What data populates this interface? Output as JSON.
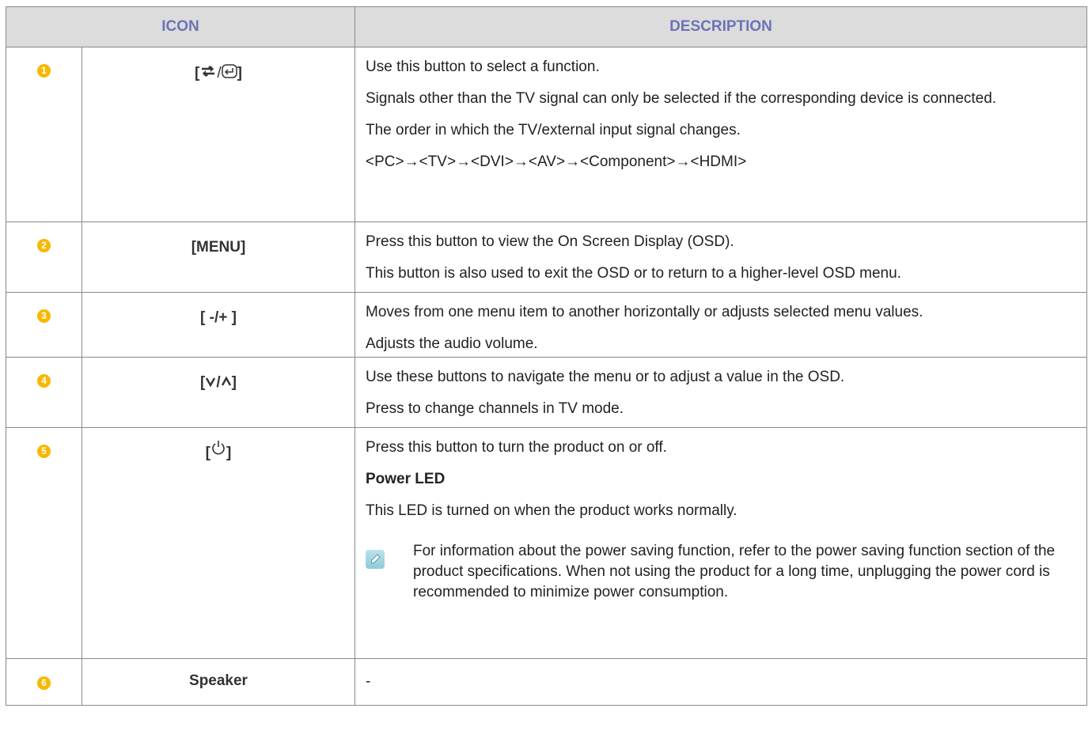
{
  "header": {
    "icon_label": "ICON",
    "description_label": "DESCRIPTION"
  },
  "colors": {
    "header_bg": "#dcdcdc",
    "header_text": "#6d73b6",
    "badge": "#f7b800",
    "border": "#8a8a8a"
  },
  "rows": [
    {
      "number": "1",
      "key": {
        "open": "[",
        "close": "]",
        "sep": "/",
        "icons": [
          "source-icon",
          "enter-icon"
        ]
      },
      "lines": [
        "Use this button to select a function.",
        "Signals other than the TV signal can only be selected if the corresponding device is connected.",
        "The order in which the TV/external input signal changes.",
        "<PC>→<TV>→<DVI>→<AV>→<Component>→<HDMI>"
      ]
    },
    {
      "number": "2",
      "key": {
        "label": "[MENU]"
      },
      "lines": [
        "Press this button to view the On Screen Display (OSD).",
        "This button is also used to exit the OSD or to return to a higher-level OSD menu."
      ]
    },
    {
      "number": "3",
      "key": {
        "label": "[ -/+ ]"
      },
      "lines": [
        "Moves from one menu item to another horizontally or adjusts selected menu values.",
        "Adjusts the audio volume."
      ]
    },
    {
      "number": "4",
      "key": {
        "open": "[",
        "close": "]",
        "icons": [
          "down-icon",
          "up-icon"
        ],
        "sep": "/"
      },
      "lines": [
        "Use these buttons to navigate the menu or to adjust a value in the OSD.",
        "Press to change channels in TV mode."
      ]
    },
    {
      "number": "5",
      "key": {
        "open": "[",
        "close": "]",
        "icons": [
          "power-icon"
        ]
      },
      "lines": [
        "Press this button to turn the product on or off.",
        "Power LED",
        "This LED is turned on when the product works normally."
      ],
      "note": "For information about the power saving function, refer to the power saving function section of the product specifications. When not using the product for a long time, unplugging the power cord is recommended to minimize power consumption."
    },
    {
      "number": "6",
      "key": {
        "label": "Speaker"
      },
      "lines": [
        "-"
      ]
    }
  ]
}
